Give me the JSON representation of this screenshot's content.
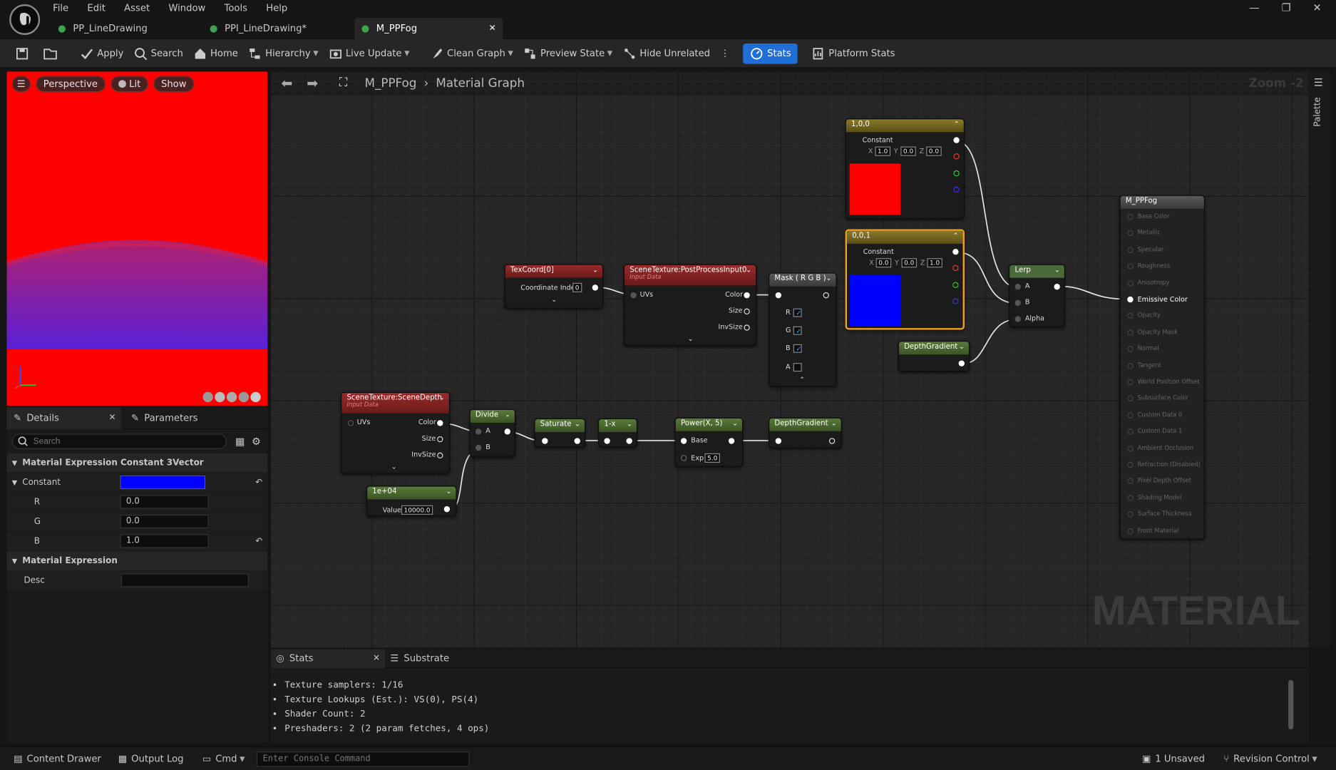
{
  "menu": [
    "File",
    "Edit",
    "Asset",
    "Window",
    "Tools",
    "Help"
  ],
  "tabs": [
    {
      "label": "PP_LineDrawing"
    },
    {
      "label": "PPI_LineDrawing*"
    },
    {
      "label": "M_PPFog"
    }
  ],
  "toolbar": {
    "apply": "Apply",
    "search": "Search",
    "home": "Home",
    "hierarchy": "Hierarchy",
    "live_update": "Live Update",
    "clean_graph": "Clean Graph",
    "preview_state": "Preview State",
    "hide_unrelated": "Hide Unrelated",
    "stats": "Stats",
    "platform_stats": "Platform Stats"
  },
  "viewport": {
    "perspective": "Perspective",
    "lit": "Lit",
    "show": "Show"
  },
  "details": {
    "tab": "Details",
    "params_tab": "Parameters",
    "search_placeholder": "Search",
    "section1": "Material Expression Constant 3Vector",
    "constant_label": "Constant",
    "constant_color": "#0000ff",
    "r_label": "R",
    "r": "0.0",
    "g_label": "G",
    "g": "0.0",
    "b_label": "B",
    "b": "1.0",
    "section2": "Material Expression",
    "desc_label": "Desc"
  },
  "graph": {
    "breadcrumb_root": "M_PPFog",
    "breadcrumb_leaf": "Material Graph",
    "zoom": "Zoom -2",
    "palette": "Palette",
    "watermark": "MATERIAL"
  },
  "nodes": {
    "texcoord": {
      "title": "TexCoord[0]",
      "label": "Coordinate Index",
      "value": "0"
    },
    "pp_input": {
      "title": "SceneTexture:PostProcessInput0",
      "sub": "Input Data",
      "uvs": "UVs",
      "color": "Color",
      "size": "Size",
      "invsize": "InvSize"
    },
    "mask": {
      "title": "Mask ( R G B )",
      "r": "R",
      "g": "G",
      "b": "B",
      "a": "A"
    },
    "c100": {
      "title": "1,0,0",
      "label": "Constant",
      "x": "1.0",
      "y": "0.0",
      "z": "0.0",
      "color": "#ff0000"
    },
    "c001": {
      "title": "0,0,1",
      "label": "Constant",
      "x": "0.0",
      "y": "0.0",
      "z": "1.0",
      "color": "#0000ff"
    },
    "axes": {
      "x": "X",
      "y": "Y",
      "z": "Z"
    },
    "lerp": {
      "title": "Lerp",
      "a": "A",
      "b": "B",
      "alpha": "Alpha"
    },
    "depthgrad_top": {
      "title": "DepthGradient"
    },
    "scenedepth": {
      "title": "SceneTexture:SceneDepth",
      "sub": "Input Data",
      "uvs": "UVs",
      "color": "Color",
      "size": "Size",
      "invsize": "InvSize"
    },
    "divide": {
      "title": "Divide",
      "a": "A",
      "b": "B"
    },
    "saturate": {
      "title": "Saturate"
    },
    "oneminus": {
      "title": "1-x"
    },
    "power": {
      "title": "Power(X, 5)",
      "base": "Base",
      "exp": "Exp",
      "exp_value": "5.0"
    },
    "depthgrad_bottom": {
      "title": "DepthGradient"
    },
    "scalar": {
      "title": "1e+04",
      "label": "Value",
      "value": "10000.0"
    },
    "output": {
      "title": "M_PPFog",
      "pins": [
        "Base Color",
        "Metallic",
        "Specular",
        "Roughness",
        "Anisotropy",
        "Emissive Color",
        "Opacity",
        "Opacity Mask",
        "Normal",
        "Tangent",
        "World Position Offset",
        "Subsurface Color",
        "Custom Data 0",
        "Custom Data 1",
        "Ambient Occlusion",
        "Refraction (Disabled)",
        "Pixel Depth Offset",
        "Shading Model",
        "Surface Thickness",
        "Front Material"
      ]
    }
  },
  "stats_panel": {
    "tab": "Stats",
    "tab2": "Substrate",
    "lines": [
      "Texture samplers: 1/16",
      "Texture Lookups (Est.): VS(0), PS(4)",
      "Shader Count: 2",
      "Preshaders: 2  (2 param fetches, 4 ops)"
    ]
  },
  "statusbar": {
    "content_drawer": "Content Drawer",
    "output_log": "Output Log",
    "cmd": "Cmd",
    "console_placeholder": "Enter Console Command",
    "unsaved": "1 Unsaved",
    "revision": "Revision Control"
  },
  "colors": {
    "accent": "#1f6fd6",
    "lerp_header": "#4a6a3a"
  }
}
